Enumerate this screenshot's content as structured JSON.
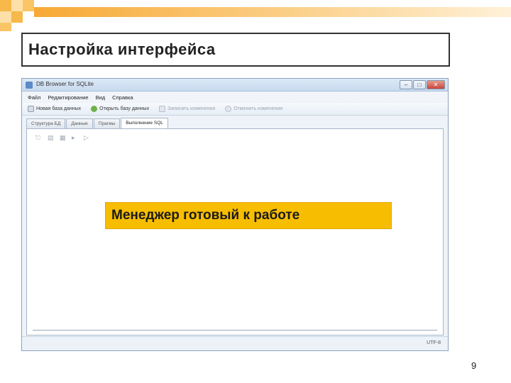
{
  "slide": {
    "title": "Настройка интерфейса",
    "callout": "Менеджер готовый к работе",
    "page_number": "9",
    "colors": {
      "accent_orange": "#f7a935",
      "callout_yellow": "#f7bd00",
      "title_border": "#333333"
    }
  },
  "app": {
    "window_title": "DB Browser for SQLite",
    "window_buttons": [
      "–",
      "□",
      "✕"
    ],
    "menu": [
      "Файл",
      "Редактирование",
      "Вид",
      "Справка"
    ],
    "toolbar": [
      {
        "label": "Новая база данных",
        "icon": "new-database-icon",
        "enabled": true
      },
      {
        "label": "Открыть базу данных",
        "icon": "open-database-icon",
        "enabled": true
      },
      {
        "label": "Записать изменения",
        "icon": "write-changes-icon",
        "enabled": false
      },
      {
        "label": "Отменить изменения",
        "icon": "revert-changes-icon",
        "enabled": false
      }
    ],
    "tabs": [
      {
        "label": "Структура БД",
        "active": false
      },
      {
        "label": "Данные",
        "active": false
      },
      {
        "label": "Прагмы",
        "active": false
      },
      {
        "label": "Выполнение SQL",
        "active": true
      }
    ],
    "editor_toolbar_icons": [
      "open-sql-icon",
      "save-sql-icon",
      "save-as-sql-icon",
      "execute-icon",
      "execute-line-icon"
    ],
    "status_encoding": "UTF-8"
  }
}
